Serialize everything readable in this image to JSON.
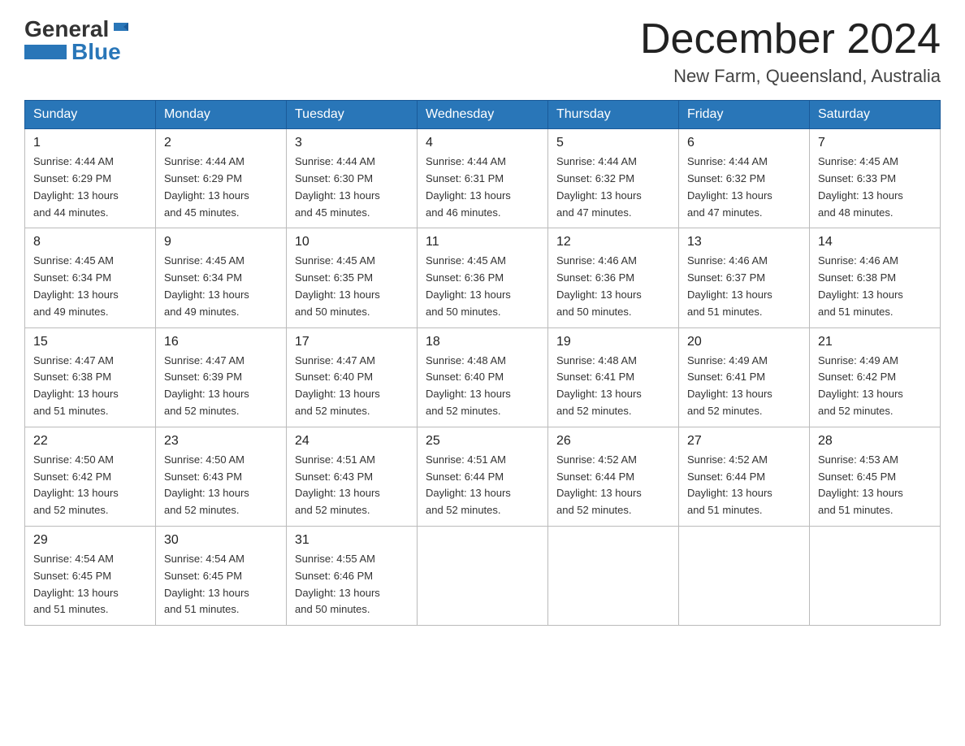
{
  "header": {
    "month_title": "December 2024",
    "location": "New Farm, Queensland, Australia"
  },
  "logo": {
    "general": "General",
    "blue": "Blue"
  },
  "days_of_week": [
    "Sunday",
    "Monday",
    "Tuesday",
    "Wednesday",
    "Thursday",
    "Friday",
    "Saturday"
  ],
  "weeks": [
    [
      {
        "day": "1",
        "sunrise": "4:44 AM",
        "sunset": "6:29 PM",
        "daylight": "13 hours and 44 minutes."
      },
      {
        "day": "2",
        "sunrise": "4:44 AM",
        "sunset": "6:29 PM",
        "daylight": "13 hours and 45 minutes."
      },
      {
        "day": "3",
        "sunrise": "4:44 AM",
        "sunset": "6:30 PM",
        "daylight": "13 hours and 45 minutes."
      },
      {
        "day": "4",
        "sunrise": "4:44 AM",
        "sunset": "6:31 PM",
        "daylight": "13 hours and 46 minutes."
      },
      {
        "day": "5",
        "sunrise": "4:44 AM",
        "sunset": "6:32 PM",
        "daylight": "13 hours and 47 minutes."
      },
      {
        "day": "6",
        "sunrise": "4:44 AM",
        "sunset": "6:32 PM",
        "daylight": "13 hours and 47 minutes."
      },
      {
        "day": "7",
        "sunrise": "4:45 AM",
        "sunset": "6:33 PM",
        "daylight": "13 hours and 48 minutes."
      }
    ],
    [
      {
        "day": "8",
        "sunrise": "4:45 AM",
        "sunset": "6:34 PM",
        "daylight": "13 hours and 49 minutes."
      },
      {
        "day": "9",
        "sunrise": "4:45 AM",
        "sunset": "6:34 PM",
        "daylight": "13 hours and 49 minutes."
      },
      {
        "day": "10",
        "sunrise": "4:45 AM",
        "sunset": "6:35 PM",
        "daylight": "13 hours and 50 minutes."
      },
      {
        "day": "11",
        "sunrise": "4:45 AM",
        "sunset": "6:36 PM",
        "daylight": "13 hours and 50 minutes."
      },
      {
        "day": "12",
        "sunrise": "4:46 AM",
        "sunset": "6:36 PM",
        "daylight": "13 hours and 50 minutes."
      },
      {
        "day": "13",
        "sunrise": "4:46 AM",
        "sunset": "6:37 PM",
        "daylight": "13 hours and 51 minutes."
      },
      {
        "day": "14",
        "sunrise": "4:46 AM",
        "sunset": "6:38 PM",
        "daylight": "13 hours and 51 minutes."
      }
    ],
    [
      {
        "day": "15",
        "sunrise": "4:47 AM",
        "sunset": "6:38 PM",
        "daylight": "13 hours and 51 minutes."
      },
      {
        "day": "16",
        "sunrise": "4:47 AM",
        "sunset": "6:39 PM",
        "daylight": "13 hours and 52 minutes."
      },
      {
        "day": "17",
        "sunrise": "4:47 AM",
        "sunset": "6:40 PM",
        "daylight": "13 hours and 52 minutes."
      },
      {
        "day": "18",
        "sunrise": "4:48 AM",
        "sunset": "6:40 PM",
        "daylight": "13 hours and 52 minutes."
      },
      {
        "day": "19",
        "sunrise": "4:48 AM",
        "sunset": "6:41 PM",
        "daylight": "13 hours and 52 minutes."
      },
      {
        "day": "20",
        "sunrise": "4:49 AM",
        "sunset": "6:41 PM",
        "daylight": "13 hours and 52 minutes."
      },
      {
        "day": "21",
        "sunrise": "4:49 AM",
        "sunset": "6:42 PM",
        "daylight": "13 hours and 52 minutes."
      }
    ],
    [
      {
        "day": "22",
        "sunrise": "4:50 AM",
        "sunset": "6:42 PM",
        "daylight": "13 hours and 52 minutes."
      },
      {
        "day": "23",
        "sunrise": "4:50 AM",
        "sunset": "6:43 PM",
        "daylight": "13 hours and 52 minutes."
      },
      {
        "day": "24",
        "sunrise": "4:51 AM",
        "sunset": "6:43 PM",
        "daylight": "13 hours and 52 minutes."
      },
      {
        "day": "25",
        "sunrise": "4:51 AM",
        "sunset": "6:44 PM",
        "daylight": "13 hours and 52 minutes."
      },
      {
        "day": "26",
        "sunrise": "4:52 AM",
        "sunset": "6:44 PM",
        "daylight": "13 hours and 52 minutes."
      },
      {
        "day": "27",
        "sunrise": "4:52 AM",
        "sunset": "6:44 PM",
        "daylight": "13 hours and 51 minutes."
      },
      {
        "day": "28",
        "sunrise": "4:53 AM",
        "sunset": "6:45 PM",
        "daylight": "13 hours and 51 minutes."
      }
    ],
    [
      {
        "day": "29",
        "sunrise": "4:54 AM",
        "sunset": "6:45 PM",
        "daylight": "13 hours and 51 minutes."
      },
      {
        "day": "30",
        "sunrise": "4:54 AM",
        "sunset": "6:45 PM",
        "daylight": "13 hours and 51 minutes."
      },
      {
        "day": "31",
        "sunrise": "4:55 AM",
        "sunset": "6:46 PM",
        "daylight": "13 hours and 50 minutes."
      },
      null,
      null,
      null,
      null
    ]
  ],
  "labels": {
    "sunrise": "Sunrise:",
    "sunset": "Sunset:",
    "daylight": "Daylight:"
  }
}
